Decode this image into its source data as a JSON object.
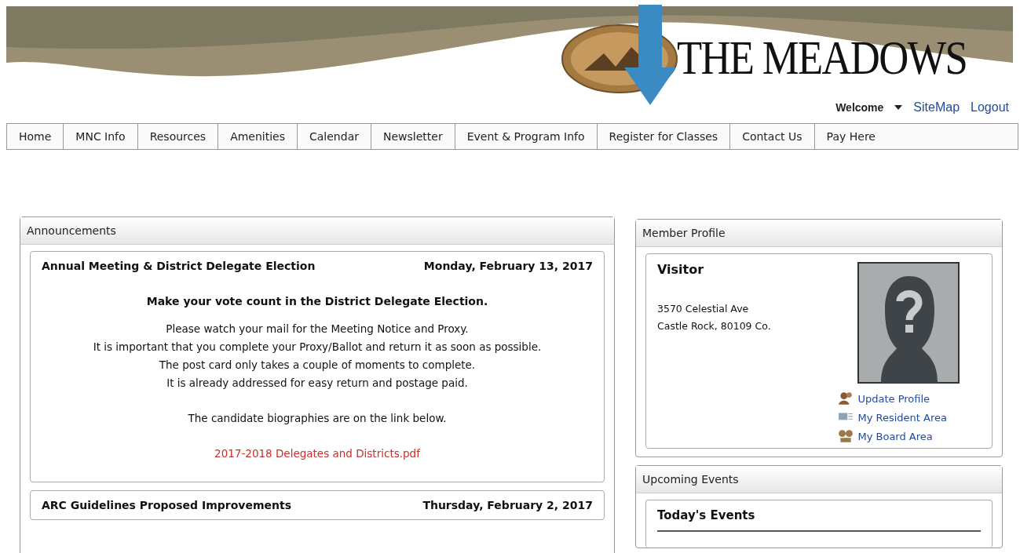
{
  "header": {
    "site_title": "THE MEADOWS",
    "user_menu": "Welcome",
    "links": [
      "SiteMap",
      "Logout"
    ]
  },
  "nav": {
    "items": [
      "Home",
      "MNC Info",
      "Resources",
      "Amenities",
      "Calendar",
      "Newsletter",
      "Event & Program Info",
      "Register for Classes",
      "Contact Us",
      "Pay Here"
    ]
  },
  "announcements": {
    "title": "Announcements",
    "items": [
      {
        "title": "Annual Meeting & District Delegate Election",
        "date": "Monday, February 13, 2017",
        "heading": "Make your vote count in the District Delegate Election.",
        "lines": [
          "Please watch your mail for the Meeting Notice and Proxy.",
          "It is important that you complete your Proxy/Ballot and return it as soon as possible.",
          "The post card only takes a couple of moments to complete.",
          "It is already addressed for easy return  and postage paid."
        ],
        "note": "The candidate biographies are on the link below.",
        "link": "2017-2018 Delegates and Districts.pdf"
      },
      {
        "title": "ARC Guidelines Proposed Improvements",
        "date": "Thursday, February 2, 2017"
      }
    ]
  },
  "member_profile": {
    "title": "Member Profile",
    "name": "Visitor",
    "address": [
      "3570 Celestial Ave",
      "Castle Rock, 80109 Co."
    ],
    "links": [
      {
        "kind": "profile",
        "label": "Update Profile"
      },
      {
        "kind": "resident",
        "label": "My Resident Area"
      },
      {
        "kind": "board",
        "label": "My Board Area"
      }
    ]
  },
  "upcoming_events": {
    "title": "Upcoming Events",
    "subtitle": "Today's Events"
  }
}
